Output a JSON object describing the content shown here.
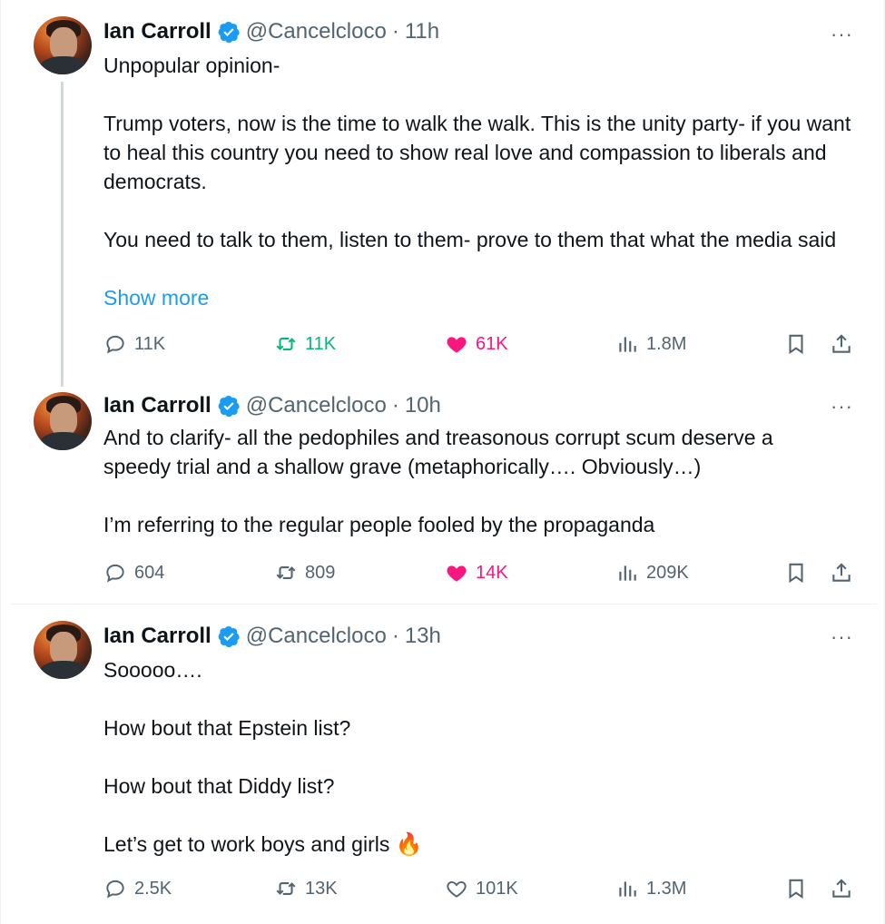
{
  "tweets": [
    {
      "name": "Ian Carroll",
      "handle": "@Cancelcloco",
      "dot": "·",
      "time": "11h",
      "more": "···",
      "paragraphs": [
        "Unpopular opinion-",
        "Trump voters, now is the time to walk the walk. This is the unity party- if you want to heal this country you need to show real love and compassion to liberals and democrats.",
        "You need to talk to them, listen to them- prove to them that what the media said"
      ],
      "show_more": "Show more",
      "replies": "11K",
      "reposts": "11K",
      "likes": "61K",
      "views": "1.8M",
      "reposted": true,
      "liked": true
    },
    {
      "name": "Ian Carroll",
      "handle": "@Cancelcloco",
      "dot": "·",
      "time": "10h",
      "more": "···",
      "paragraphs": [
        "And to clarify- all the pedophiles and treasonous corrupt scum deserve a speedy trial and a shallow grave (metaphorically…. Obviously…)",
        "I’m referring to the regular people fooled by the propaganda"
      ],
      "replies": "604",
      "reposts": "809",
      "likes": "14K",
      "views": "209K",
      "reposted": false,
      "liked": true
    },
    {
      "name": "Ian Carroll",
      "handle": "@Cancelcloco",
      "dot": "·",
      "time": "13h",
      "more": "···",
      "paragraphs": [
        "Sooooo….",
        "How bout that Epstein list?",
        "How bout that Diddy list?",
        "Let’s get to work boys and girls"
      ],
      "emoji": "🔥",
      "replies": "2.5K",
      "reposts": "13K",
      "likes": "101K",
      "views": "1.3M",
      "reposted": false,
      "liked": false
    }
  ],
  "colors": {
    "accent": "#1d9bf0",
    "repost": "#00ba7c",
    "like": "#f91880",
    "muted": "#536471"
  },
  "icons": [
    "reply-icon",
    "repost-icon",
    "heart-icon",
    "views-icon",
    "bookmark-icon",
    "share-icon",
    "verified-badge-icon",
    "more-icon"
  ]
}
